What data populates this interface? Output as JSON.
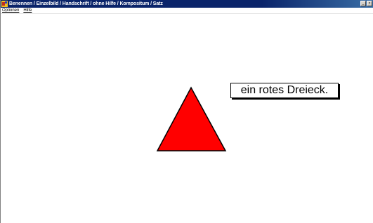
{
  "window": {
    "title": "Benennen / Einzelbild / Handschrift / ohne Hilfe / Kompositum / Satz"
  },
  "menu": {
    "items": [
      "Optionen",
      "Hilfe"
    ]
  },
  "stimulus": {
    "shape": "triangle",
    "color": "#ff0000",
    "caption": "ein rotes Dreieck."
  },
  "icons": {
    "app": "app-icon",
    "minimize": "minimize-icon",
    "close": "close-icon"
  }
}
